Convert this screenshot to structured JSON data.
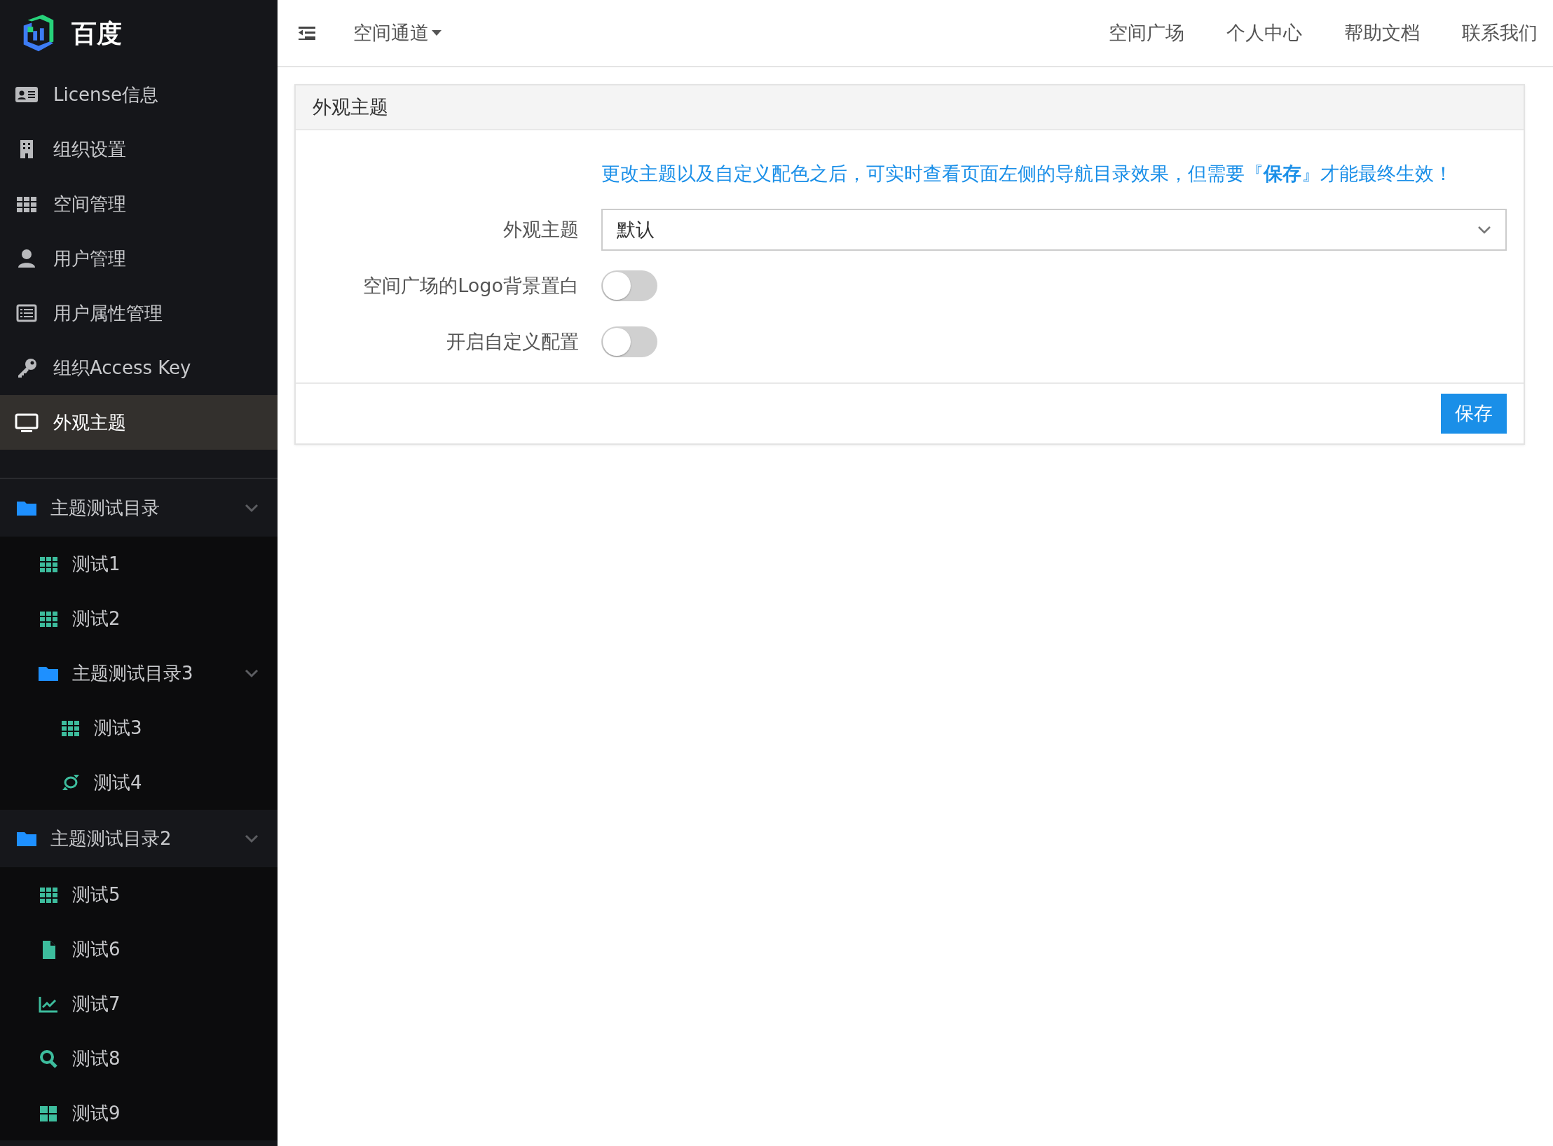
{
  "sidebar": {
    "logo_text": "百度",
    "menu": [
      {
        "label": "License信息",
        "selected": false
      },
      {
        "label": "组织设置",
        "selected": false
      },
      {
        "label": "空间管理",
        "selected": false
      },
      {
        "label": "用户管理",
        "selected": false
      },
      {
        "label": "用户属性管理",
        "selected": false
      },
      {
        "label": "组织Access Key",
        "selected": false
      },
      {
        "label": "外观主题",
        "selected": true
      }
    ],
    "tree": [
      {
        "kind": "folder",
        "label": "主题测试目录",
        "expanded": true,
        "children": [
          {
            "kind": "grid",
            "label": "测试1"
          },
          {
            "kind": "grid",
            "label": "测试2"
          },
          {
            "kind": "folder",
            "label": "主题测试目录3",
            "expanded": true,
            "children": [
              {
                "kind": "grid",
                "label": "测试3"
              },
              {
                "kind": "link",
                "label": "测试4"
              }
            ]
          }
        ]
      },
      {
        "kind": "folder",
        "label": "主题测试目录2",
        "expanded": true,
        "children": [
          {
            "kind": "grid",
            "label": "测试5"
          },
          {
            "kind": "file",
            "label": "测试6"
          },
          {
            "kind": "chart",
            "label": "测试7"
          },
          {
            "kind": "search",
            "label": "测试8"
          },
          {
            "kind": "tiles",
            "label": "测试9"
          }
        ]
      }
    ]
  },
  "topbar": {
    "dropdown": "空间通道",
    "links": [
      "空间广场",
      "个人中心",
      "帮助文档",
      "联系我们"
    ]
  },
  "card": {
    "title": "外观主题",
    "hint": "更改主题以及自定义配色之后，可实时查看页面左侧的导航目录效果，但需要『**保存**』才能最终生效！",
    "fields": [
      {
        "kind": "select",
        "label": "外观主题",
        "value": "默认"
      },
      {
        "kind": "switch",
        "label": "空间广场的Logo背景置白",
        "on": false
      },
      {
        "kind": "switch",
        "label": "开启自定义配置",
        "on": false
      }
    ],
    "button": "保存"
  }
}
